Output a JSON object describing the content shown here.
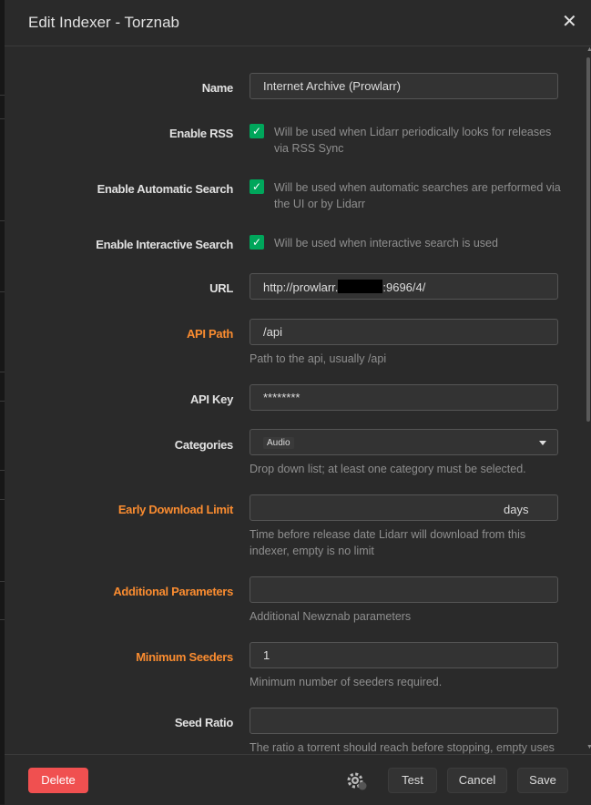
{
  "modal": {
    "title": "Edit Indexer - Torznab",
    "close_glyph": "✕"
  },
  "fields": {
    "name": {
      "label": "Name",
      "value": "Internet Archive (Prowlarr)"
    },
    "enable_rss": {
      "label": "Enable RSS",
      "checked": true,
      "help": "Will be used when Lidarr periodically looks for releases via RSS Sync"
    },
    "enable_auto_search": {
      "label": "Enable Automatic Search",
      "checked": true,
      "help": "Will be used when automatic searches are performed via the UI or by Lidarr"
    },
    "enable_interactive_search": {
      "label": "Enable Interactive Search",
      "checked": true,
      "help": "Will be used when interactive search is used"
    },
    "url": {
      "label": "URL",
      "value_prefix": "http://prowlarr.",
      "value_suffix": ":9696/4/"
    },
    "api_path": {
      "label": "API Path",
      "value": "/api",
      "help": "Path to the api, usually /api"
    },
    "api_key": {
      "label": "API Key",
      "value": "********"
    },
    "categories": {
      "label": "Categories",
      "tag": "Audio",
      "help": "Drop down list; at least one category must be selected."
    },
    "early_download_limit": {
      "label": "Early Download Limit",
      "value": "",
      "suffix": "days",
      "help": "Time before release date Lidarr will download from this indexer, empty is no limit"
    },
    "additional_parameters": {
      "label": "Additional Parameters",
      "value": "",
      "help": "Additional Newznab parameters"
    },
    "minimum_seeders": {
      "label": "Minimum Seeders",
      "value": "1",
      "help": "Minimum number of seeders required."
    },
    "seed_ratio": {
      "label": "Seed Ratio",
      "value": "",
      "help": "The ratio a torrent should reach before stopping, empty uses"
    }
  },
  "footer": {
    "delete_label": "Delete",
    "test_label": "Test",
    "cancel_label": "Cancel",
    "save_label": "Save"
  },
  "icons": {
    "check": "check-icon",
    "close": "close-icon",
    "gear": "gear-icon",
    "caret": "caret-down-icon"
  },
  "colors": {
    "advanced_label": "#fa8c30",
    "checkbox": "#00a65b",
    "danger": "#f05050"
  }
}
